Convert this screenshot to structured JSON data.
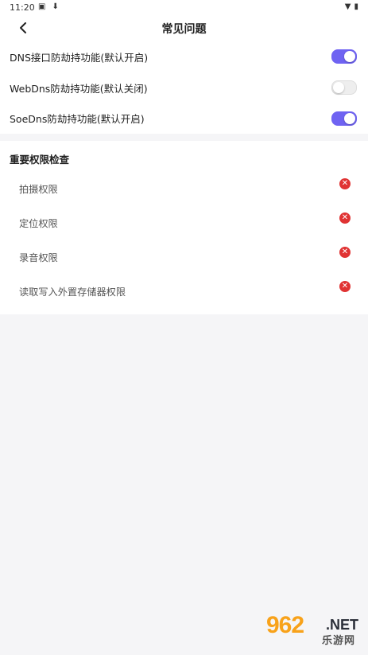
{
  "status_bar": {
    "time": "11:20",
    "left_icons": [
      "notification-icon",
      "download-icon"
    ],
    "right_icons": [
      "wifi-icon",
      "battery-icon"
    ]
  },
  "header": {
    "title": "常见问题"
  },
  "toggles": [
    {
      "label": "DNS接口防劫持功能(默认开启)",
      "state": true
    },
    {
      "label": "WebDns防劫持功能(默认关闭)",
      "state": false
    },
    {
      "label": "SoeDns防劫持功能(默认开启)",
      "state": true
    }
  ],
  "permissions": {
    "heading": "重要权限检查",
    "items": [
      {
        "label": "拍摄权限"
      },
      {
        "label": "定位权限"
      },
      {
        "label": "录音权限"
      },
      {
        "label": "读取写入外置存储器权限"
      }
    ]
  },
  "watermark": {
    "brand": "962",
    "suffix": ".NET",
    "subtitle": "乐游网"
  },
  "colors": {
    "accent": "#6f63f2",
    "error": "#e03333"
  }
}
